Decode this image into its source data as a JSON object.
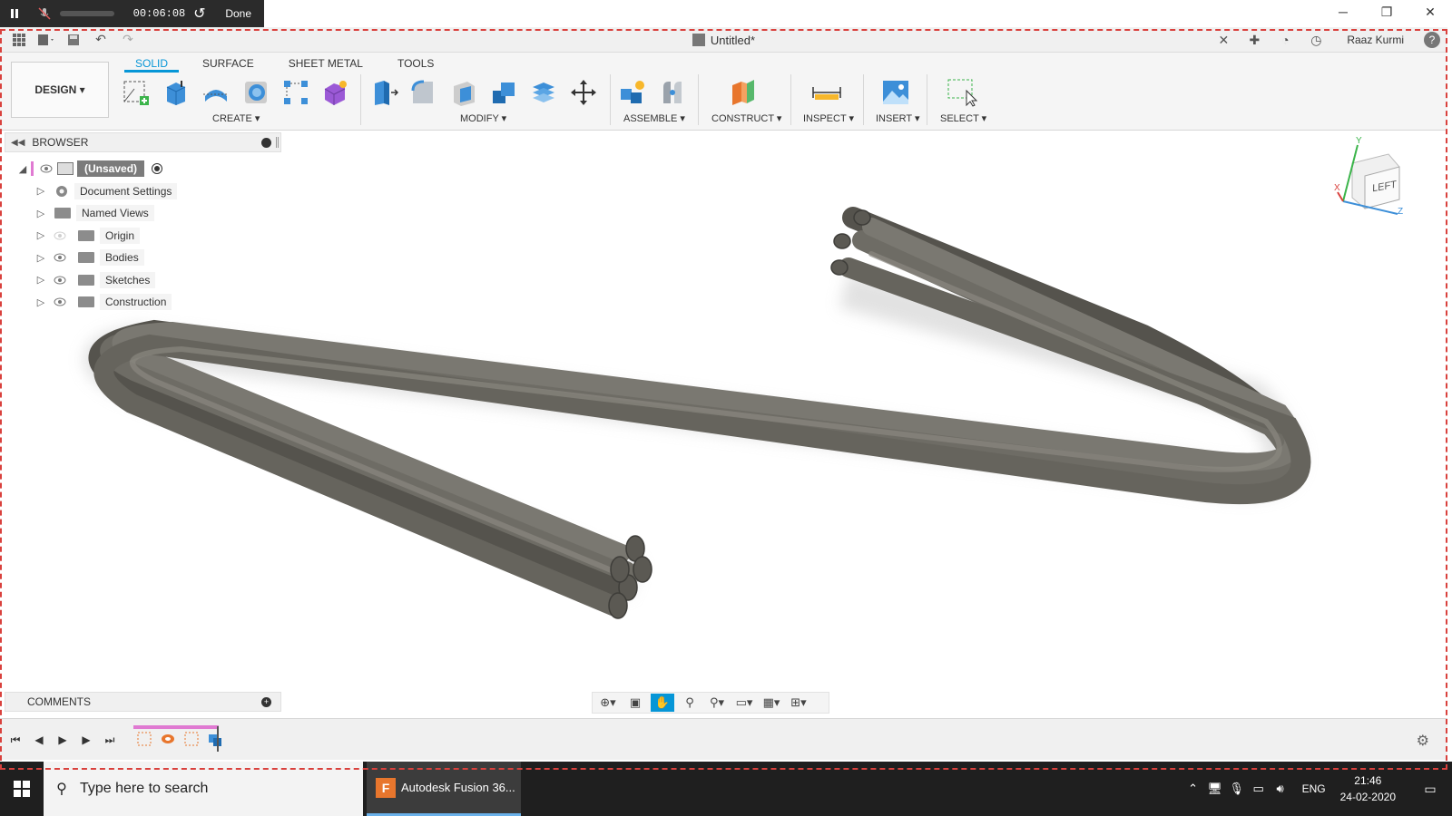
{
  "recorder": {
    "time": "00:06:08",
    "done_label": "Done"
  },
  "window": {
    "minimize": "─",
    "restore": "❐",
    "close": "✕"
  },
  "app": {
    "doc_title": "Untitled*",
    "close_tab": "✕",
    "user_name": "Raaz Kurmi",
    "help": "?"
  },
  "ribbon": {
    "workspace": "DESIGN ▾",
    "tabs": [
      "SOLID",
      "SURFACE",
      "SHEET METAL",
      "TOOLS"
    ],
    "groups": {
      "create": "CREATE ▾",
      "modify": "MODIFY ▾",
      "assemble": "ASSEMBLE ▾",
      "construct": "CONSTRUCT ▾",
      "inspect": "INSPECT ▾",
      "insert": "INSERT ▾",
      "select": "SELECT ▾"
    }
  },
  "browser": {
    "title": "BROWSER",
    "root": "(Unsaved)",
    "items": [
      {
        "label": "Document Settings",
        "icon": "gear-icon"
      },
      {
        "label": "Named Views",
        "icon": "folder-icon"
      },
      {
        "label": "Origin",
        "icon": "folder-icon"
      },
      {
        "label": "Bodies",
        "icon": "folder-icon"
      },
      {
        "label": "Sketches",
        "icon": "folder-icon"
      },
      {
        "label": "Construction",
        "icon": "folder-icon"
      }
    ]
  },
  "viewcube": {
    "face": "LEFT",
    "axis_y": "Y",
    "axis_z": "Z",
    "axis_x": "X"
  },
  "comments": {
    "title": "COMMENTS"
  },
  "taskbar": {
    "search_placeholder": "Type here to search",
    "app_label": "Autodesk Fusion 36...",
    "lang": "ENG",
    "time": "21:46",
    "date": "24-02-2020"
  },
  "colors": {
    "accent": "#0696d7",
    "record_border": "#d9413d",
    "cable": "#6e6c65",
    "timeline_pink": "#e07ad2"
  }
}
